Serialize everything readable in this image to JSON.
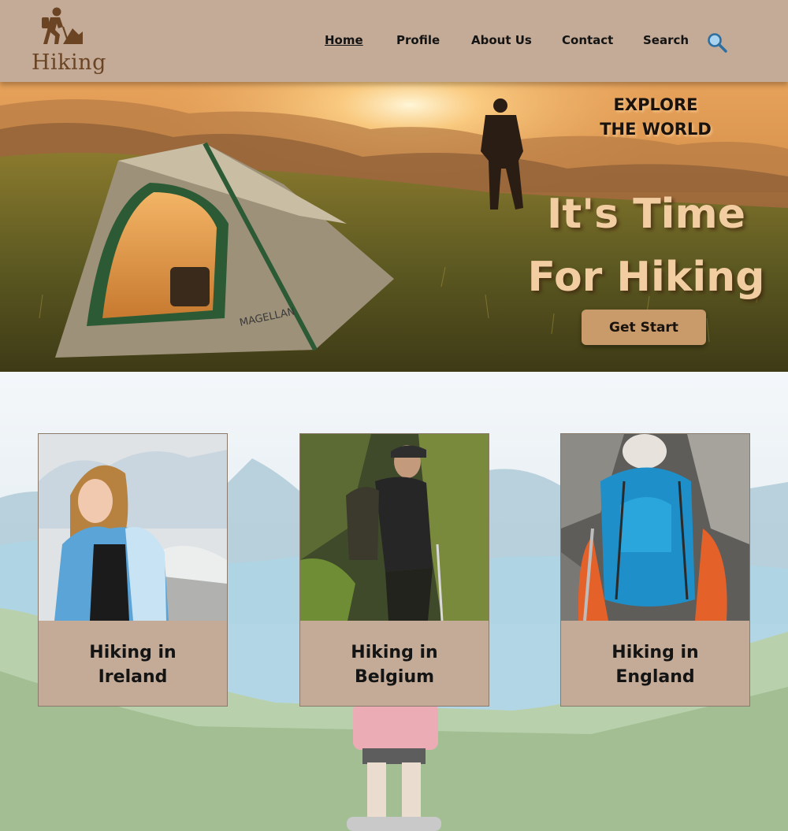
{
  "brand": {
    "name": "Hiking",
    "logo_icon": "hiker-icon"
  },
  "nav": {
    "items": [
      {
        "label": "Home",
        "active": true
      },
      {
        "label": "Profile",
        "active": false
      },
      {
        "label": "About Us",
        "active": false
      },
      {
        "label": "Contact",
        "active": false
      },
      {
        "label": "Search",
        "active": false
      }
    ],
    "search_icon": "magnifier-icon"
  },
  "hero": {
    "eyebrow_line1": "EXPLORE",
    "eyebrow_line2": "THE WORLD",
    "headline_line1": "It's Time",
    "headline_line2": "For Hiking",
    "cta_label": "Get Start",
    "tent_brand": "MAGELLAN"
  },
  "cards": [
    {
      "title_line1": "Hiking in",
      "title_line2": "Ireland"
    },
    {
      "title_line1": "Hiking in",
      "title_line2": "Belgium"
    },
    {
      "title_line1": "Hiking in",
      "title_line2": "England"
    }
  ],
  "colors": {
    "header_bg": "#c3ab97",
    "accent": "#c99a6a",
    "headline": "#f2cda2",
    "brand_brown": "#6b4424"
  }
}
